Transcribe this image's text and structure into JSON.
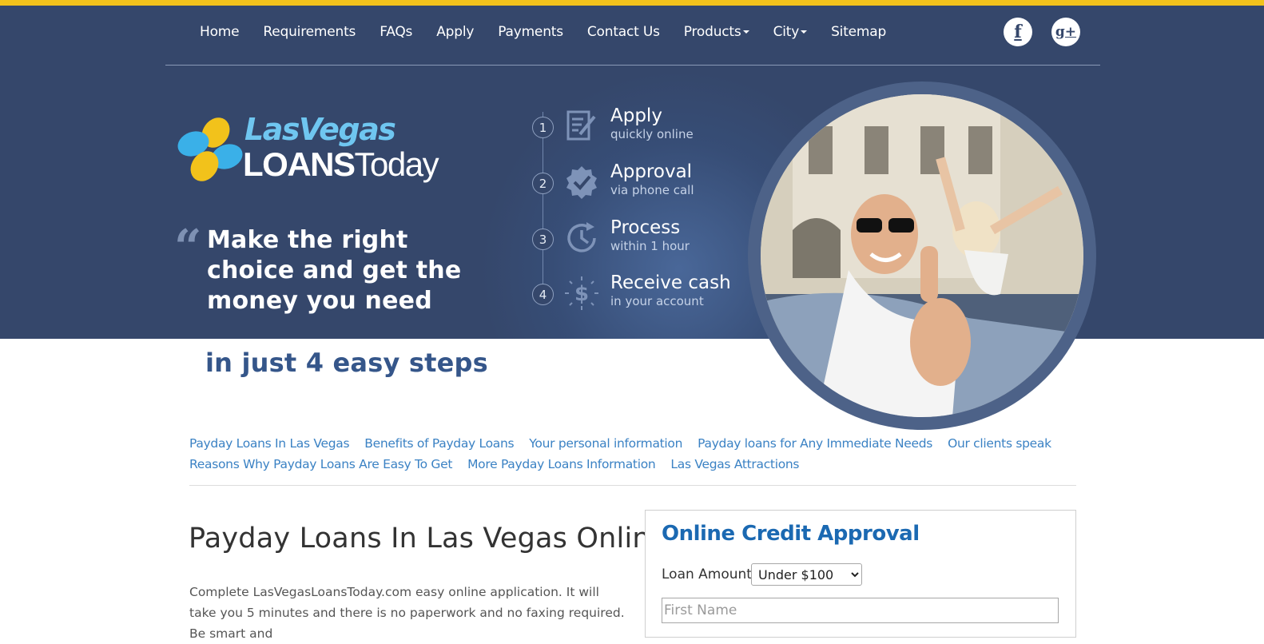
{
  "nav": {
    "items": [
      {
        "label": "Home"
      },
      {
        "label": "Requirements"
      },
      {
        "label": "FAQs"
      },
      {
        "label": "Apply"
      },
      {
        "label": "Payments"
      },
      {
        "label": "Contact Us"
      },
      {
        "label": "Products",
        "dropdown": true
      },
      {
        "label": "City",
        "dropdown": true
      },
      {
        "label": "Sitemap"
      }
    ],
    "social": [
      {
        "icon": "facebook-icon",
        "glyph": "f"
      },
      {
        "icon": "google-plus-icon",
        "glyph": "g+"
      }
    ]
  },
  "logo": {
    "line1": "LasVegas",
    "line2_bold": "LOANS",
    "line2_rest": "Today"
  },
  "hero": {
    "quote_mark": "“",
    "tagline": "Make the right choice and get  the money you need",
    "tagline2": "in just 4 easy steps"
  },
  "steps": [
    {
      "num": "1",
      "title": "Apply",
      "sub": "quickly online",
      "icon": "document-pen-icon"
    },
    {
      "num": "2",
      "title": "Approval",
      "sub": "via phone call",
      "icon": "checkmark-badge-icon"
    },
    {
      "num": "3",
      "title": "Process",
      "sub": "within 1 hour",
      "icon": "clock-icon"
    },
    {
      "num": "4",
      "title": "Receive cash",
      "sub": "in your account",
      "icon": "dollar-icon"
    }
  ],
  "links": {
    "row1": [
      "Payday Loans In Las Vegas",
      "Benefits of Payday Loans",
      "Your personal information",
      "Payday loans for Any Immediate Needs",
      "Our clients speak"
    ],
    "row2": [
      "Reasons Why Payday Loans Are Easy To Get",
      "More Payday Loans Information",
      "Las Vegas Attractions"
    ]
  },
  "main": {
    "title": "Payday Loans In Las Vegas Online",
    "body": "Complete LasVegasLoansToday.com easy online application. It will take you 5 minutes and there is no paperwork and no faxing required. Be smart and"
  },
  "form": {
    "title": "Online Credit Approval",
    "loan_amount_label": "Loan Amount",
    "loan_amount_value": "Under $100",
    "first_name_placeholder": "First Name"
  },
  "colors": {
    "accent_bar": "#f2c21b",
    "hero_bg": "#35476b",
    "link": "#3b82c4",
    "form_title": "#1b69b2"
  }
}
